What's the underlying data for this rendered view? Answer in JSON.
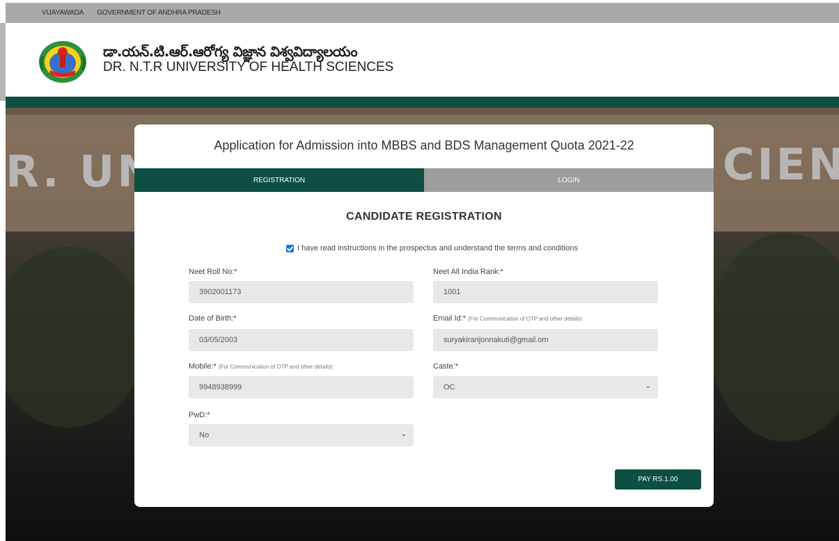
{
  "topbar": {
    "city": "VIJAYAWADA",
    "govt": "GOVERNMENT OF ANDHRA PRADESH"
  },
  "header": {
    "telugu_name": "డా.యన్.టి.ఆర్.ఆరోగ్య విజ్ఞాన విశ్వవిద్యాలయం",
    "english_name": "DR. N.T.R UNIVERSITY OF HEALTH SCIENCES",
    "colors": {
      "brand_green": "#0e4f42"
    }
  },
  "card": {
    "title": "Application for Admission into MBBS and BDS Management Quota 2021-22",
    "tabs": [
      {
        "label": "REGISTRATION",
        "active": true
      },
      {
        "label": "LOGIN",
        "active": false
      }
    ],
    "section_title": "CANDIDATE REGISTRATION",
    "agreement": {
      "checked": true,
      "text": "I have read instructions in the prospectus and understand the terms and conditions"
    },
    "form": {
      "neet_roll": {
        "label": "Neet Roll No:*",
        "value": "3902001173"
      },
      "neet_rank": {
        "label": "Neet All India Rank:*",
        "value": "1001"
      },
      "dob": {
        "label": "Date of Birth:*",
        "value": "03/05/2003"
      },
      "email": {
        "label": "Email Id:*",
        "hint": "(For Communication of OTP and other details)",
        "value": "suryakiranjonnakuti@gmail.om"
      },
      "mobile": {
        "label": "Mobile:*",
        "hint": "(For Communication of OTP and other details)",
        "value": "9948938999"
      },
      "caste": {
        "label": "Caste:*",
        "selected": "OC"
      },
      "pwd": {
        "label": "PwD:*",
        "selected": "No"
      }
    },
    "pay_button": "PAY RS.1.00"
  }
}
